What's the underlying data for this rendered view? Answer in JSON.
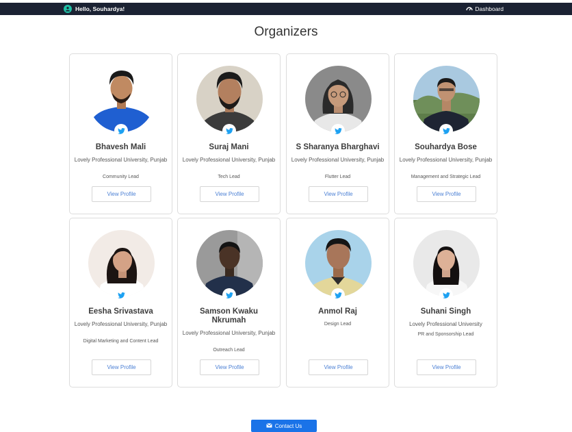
{
  "header": {
    "greeting": "Hello, Souhardya!",
    "dashboard_label": "Dashboard"
  },
  "page": {
    "title": "Organizers"
  },
  "organizers": [
    {
      "name": "Bhavesh Mali",
      "university": "Lovely Professional University, Punjab",
      "role": "Community Lead",
      "button": "View Profile"
    },
    {
      "name": "Suraj Mani",
      "university": "Lovely Professional University, Punjab",
      "role": "Tech Lead",
      "button": "View Profile"
    },
    {
      "name": "S Sharanya Bharghavi",
      "university": "Lovely Professional University, Punjab",
      "role": "Flutter Lead",
      "button": "View Profile"
    },
    {
      "name": "Souhardya Bose",
      "university": "Lovely Professional University, Punjab",
      "role": "Management and Strategic Lead",
      "button": "View Profile"
    },
    {
      "name": "Eesha Srivastava",
      "university": "Lovely Professional University, Punjab",
      "role": "Digital Marketing and Content Lead",
      "button": "View Profile"
    },
    {
      "name": "Samson Kwaku Nkrumah",
      "university": "Lovely Professional University, Punjab",
      "role": "Outreach Lead",
      "button": "View Profile"
    },
    {
      "name": "Anmol Raj",
      "role": "Design Lead",
      "button": "View Profile"
    },
    {
      "name": "Suhani Singh",
      "university": "Lovely Professional University",
      "role": "PR and Sponsorship Lead",
      "button": "View Profile"
    }
  ],
  "footer": {
    "contact_label": "Contact Us"
  },
  "icons": {
    "avatar_badge": "twitter-icon",
    "dashboard": "speedometer-icon",
    "contact": "envelope-icon",
    "greeting": "user-badge-icon"
  },
  "colors": {
    "topbar": "#1b2233",
    "accent": "#1a73e8",
    "twitter": "#1da1f2",
    "link": "#4a7fd4"
  }
}
